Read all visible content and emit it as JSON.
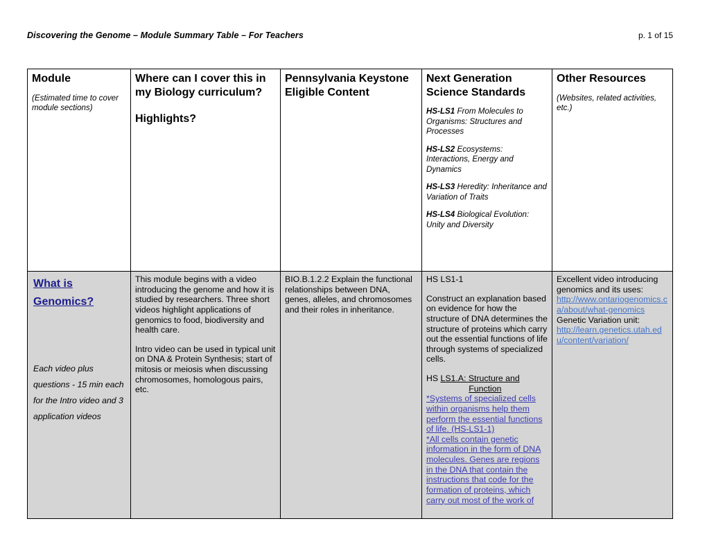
{
  "page_header": {
    "title": "Discovering the Genome – Module Summary Table – For Teachers",
    "folio": "p. 1 of 15"
  },
  "table": {
    "columns": [
      {
        "id": "module",
        "title": "Module",
        "subtitle": "(Estimated time to cover module sections)"
      },
      {
        "id": "where",
        "title": "Where can I cover this in my Biology curriculum?",
        "title2": "Highlights?"
      },
      {
        "id": "keystone",
        "title": "Pennsylvania Keystone Eligible Content"
      },
      {
        "id": "ngss",
        "title": "Next Generation Science Standards",
        "codes": [
          {
            "code": "HS-LS1",
            "text": " From Molecules to Organisms: Structures and Processes"
          },
          {
            "code": "HS-LS2",
            "text": " Ecosystems: Interactions, Energy and Dynamics"
          },
          {
            "code": "HS-LS3",
            "text": " Heredity: Inheritance and Variation of Traits"
          },
          {
            "code": "HS-LS4",
            "text": " Biological Evolution: Unity and Diversity"
          }
        ]
      },
      {
        "id": "other",
        "title": "Other Resources",
        "subtitle": "(Websites, related activities, etc.)"
      }
    ],
    "rows": [
      {
        "module": {
          "link_label": "What is Genomics?",
          "note": "Each video plus questions - 15 min each for the Intro video and 3 application videos"
        },
        "where": {
          "para1": "This module begins with a video introducing the genome and how it is studied by researchers. Three short videos highlight applications of genomics to food, biodiversity and health care.",
          "para2": "Intro video can be used in typical unit on DNA & Protein Synthesis; start of mitosis or meiosis when discussing chromosomes, homologous pairs, etc."
        },
        "keystone": {
          "text": "BIO.B.1.2.2 Explain the functional relationships between DNA, genes, alleles, and chromosomes and their roles in inheritance."
        },
        "ngss": {
          "code": "HS LS1-1",
          "statement": "Construct an explanation based on evidence for how the structure of DNA determines the structure of proteins which carry out the essential functions of life through systems of specialized cells.",
          "sub_prefix": "HS ",
          "sub_head_line1": "LS1.A: Structure and",
          "sub_head_line2": "Function",
          "bullet1": "*Systems of specialized cells within organisms help them perform the essential functions of life. (HS-LS1-1)",
          "bullet2": "*All cells contain genetic information in the form of DNA molecules. Genes are regions in the DNA that contain the instructions that code for the formation of proteins, which carry out most of the work of"
        },
        "other": {
          "label1": "Excellent video introducing genomics and its uses:",
          "url1": "http://www.ontariogenomics.ca/about/what-genomics",
          "label2": "Genetic Variation unit:",
          "url2": "http://learn.genetics.utah.edu/content/variation/"
        }
      }
    ]
  },
  "colors": {
    "cell_fill": "#d5d5d5",
    "module_link": "#1c1c8c",
    "ngss_link": "#3a3ab4",
    "resource_link": "#4272c8"
  }
}
